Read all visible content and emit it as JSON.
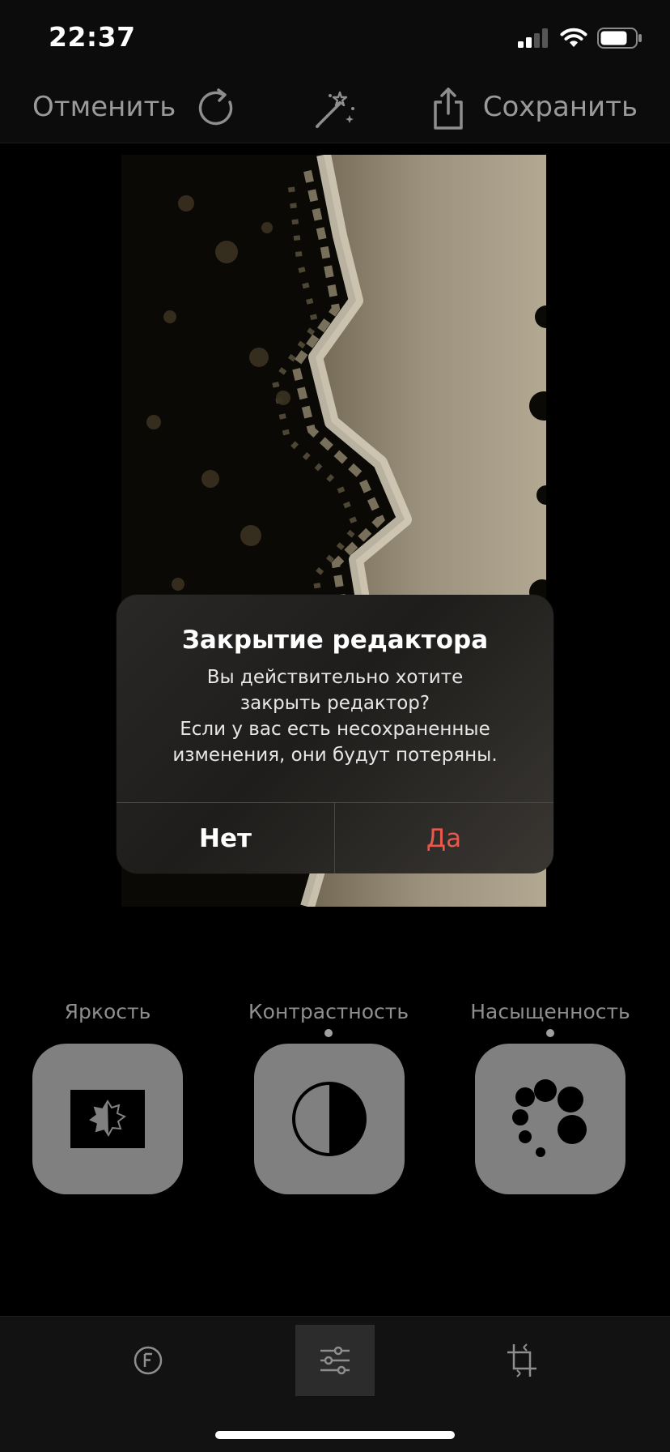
{
  "status": {
    "time": "22:37"
  },
  "toolbar": {
    "cancel_label": "Отменить",
    "save_label": "Сохранить"
  },
  "dialog": {
    "title": "Закрытие редактора",
    "message_lines": [
      "Вы действительно хотите",
      "закрыть редактор?",
      "Если у вас есть несохраненные",
      "изменения, они будут потеряны."
    ],
    "no_label": "Нет",
    "yes_label": "Да",
    "yes_color": "#e8584d"
  },
  "tools": [
    {
      "label": "Яркость",
      "icon": "brightness-icon",
      "dot": false
    },
    {
      "label": "Контрастность",
      "icon": "contrast-icon",
      "dot": true
    },
    {
      "label": "Насыщенность",
      "icon": "saturation-icon",
      "dot": true
    }
  ],
  "tabs": [
    {
      "icon": "filters-icon",
      "active": false
    },
    {
      "icon": "adjust-sliders-icon",
      "active": true
    },
    {
      "icon": "crop-rotate-icon",
      "active": false
    }
  ]
}
